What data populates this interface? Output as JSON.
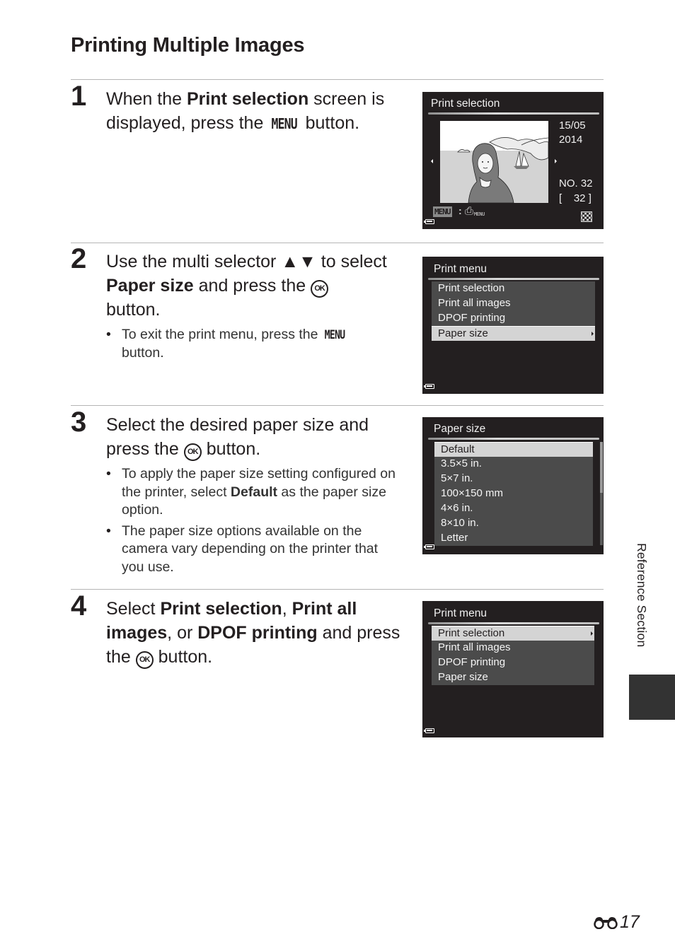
{
  "page_title": "Printing Multiple Images",
  "steps": [
    {
      "number": "1",
      "text_parts": [
        "When the ",
        "Print selection",
        " screen is displayed, press the ",
        "MENU",
        " button."
      ]
    },
    {
      "number": "2",
      "text_parts": [
        "Use the multi selector ",
        "▲▼",
        " to select ",
        "Paper size",
        " and press the ",
        "OK",
        " button."
      ],
      "bullets": [
        {
          "parts": [
            "To exit the print menu, press the ",
            "MENU",
            " button."
          ]
        }
      ]
    },
    {
      "number": "3",
      "text_parts": [
        "Select the desired paper size and press the ",
        "OK",
        " button."
      ],
      "bullets": [
        {
          "parts": [
            "To apply the paper size setting configured on the printer, select ",
            "Default",
            " as the paper size option."
          ]
        },
        {
          "parts": [
            "The paper size options available on the camera vary depending on the printer that you use."
          ]
        }
      ]
    },
    {
      "number": "4",
      "text_parts": [
        "Select ",
        "Print selection",
        ", ",
        "Print all images",
        ", or ",
        "DPOF printing",
        " and press the ",
        "OK",
        " button."
      ]
    }
  ],
  "screens": {
    "print_selection": {
      "title": "Print selection",
      "date": "15/05",
      "year": "2014",
      "number_label": "NO. 32",
      "count_label": "[    32 ]",
      "menu_badge": "MENU",
      "print_menu_sub": "MENU"
    },
    "print_menu_a": {
      "title": "Print menu",
      "items": [
        "Print selection",
        "Print all images",
        "DPOF printing",
        "Paper size"
      ],
      "selected_index": 3
    },
    "paper_size": {
      "title": "Paper size",
      "items": [
        "Default",
        "3.5×5 in.",
        "5×7 in.",
        "100×150 mm",
        "4×6 in.",
        "8×10 in.",
        "Letter"
      ],
      "selected_index": 0
    },
    "print_menu_b": {
      "title": "Print menu",
      "items": [
        "Print selection",
        "Print all images",
        "DPOF printing",
        "Paper size"
      ],
      "selected_index": 0
    }
  },
  "side_tab": {
    "label": "Reference Section"
  },
  "footer": {
    "page_number": "17",
    "section_icon": "binoculars-icon"
  },
  "colors": {
    "screen_bg": "#231f20",
    "menu_item": "#4b4b4b",
    "menu_selected": "#d4d4d4",
    "side_block": "#333333"
  }
}
